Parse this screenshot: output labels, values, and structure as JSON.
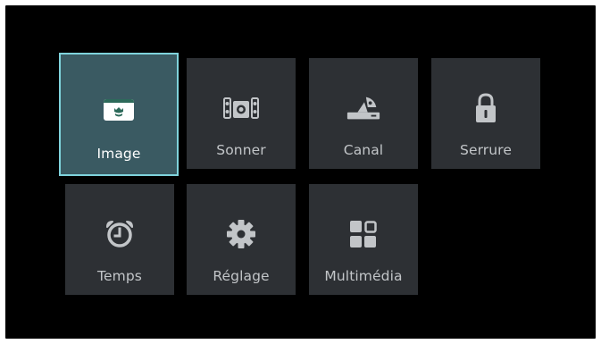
{
  "menu": {
    "items": [
      {
        "label": "Image",
        "icon": "image-icon",
        "selected": true
      },
      {
        "label": "Sonner",
        "icon": "speaker-icon",
        "selected": false
      },
      {
        "label": "Canal",
        "icon": "satellite-dish-icon",
        "selected": false
      },
      {
        "label": "Serrure",
        "icon": "lock-icon",
        "selected": false
      },
      {
        "label": "Temps",
        "icon": "alarm-clock-icon",
        "selected": false
      },
      {
        "label": "Réglage",
        "icon": "gear-icon",
        "selected": false
      },
      {
        "label": "Multimédia",
        "icon": "grid-icon",
        "selected": false
      }
    ]
  },
  "colors": {
    "background": "#000000",
    "tile": "#2d3034",
    "tile_selected": "#3a5a62",
    "selected_border": "#7fd3dc",
    "icon": "#c2c5c8",
    "icon_selected": "#ffffff",
    "accent_green": "#2d6a5a"
  }
}
